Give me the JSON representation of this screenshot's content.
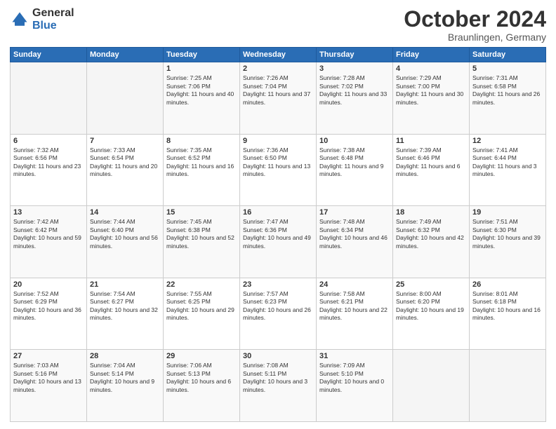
{
  "header": {
    "logo_general": "General",
    "logo_blue": "Blue",
    "month_title": "October 2024",
    "location": "Braunlingen, Germany"
  },
  "weekdays": [
    "Sunday",
    "Monday",
    "Tuesday",
    "Wednesday",
    "Thursday",
    "Friday",
    "Saturday"
  ],
  "weeks": [
    [
      {
        "day": "",
        "empty": true
      },
      {
        "day": "",
        "empty": true
      },
      {
        "day": "1",
        "sunrise": "Sunrise: 7:25 AM",
        "sunset": "Sunset: 7:06 PM",
        "daylight": "Daylight: 11 hours and 40 minutes."
      },
      {
        "day": "2",
        "sunrise": "Sunrise: 7:26 AM",
        "sunset": "Sunset: 7:04 PM",
        "daylight": "Daylight: 11 hours and 37 minutes."
      },
      {
        "day": "3",
        "sunrise": "Sunrise: 7:28 AM",
        "sunset": "Sunset: 7:02 PM",
        "daylight": "Daylight: 11 hours and 33 minutes."
      },
      {
        "day": "4",
        "sunrise": "Sunrise: 7:29 AM",
        "sunset": "Sunset: 7:00 PM",
        "daylight": "Daylight: 11 hours and 30 minutes."
      },
      {
        "day": "5",
        "sunrise": "Sunrise: 7:31 AM",
        "sunset": "Sunset: 6:58 PM",
        "daylight": "Daylight: 11 hours and 26 minutes."
      }
    ],
    [
      {
        "day": "6",
        "sunrise": "Sunrise: 7:32 AM",
        "sunset": "Sunset: 6:56 PM",
        "daylight": "Daylight: 11 hours and 23 minutes."
      },
      {
        "day": "7",
        "sunrise": "Sunrise: 7:33 AM",
        "sunset": "Sunset: 6:54 PM",
        "daylight": "Daylight: 11 hours and 20 minutes."
      },
      {
        "day": "8",
        "sunrise": "Sunrise: 7:35 AM",
        "sunset": "Sunset: 6:52 PM",
        "daylight": "Daylight: 11 hours and 16 minutes."
      },
      {
        "day": "9",
        "sunrise": "Sunrise: 7:36 AM",
        "sunset": "Sunset: 6:50 PM",
        "daylight": "Daylight: 11 hours and 13 minutes."
      },
      {
        "day": "10",
        "sunrise": "Sunrise: 7:38 AM",
        "sunset": "Sunset: 6:48 PM",
        "daylight": "Daylight: 11 hours and 9 minutes."
      },
      {
        "day": "11",
        "sunrise": "Sunrise: 7:39 AM",
        "sunset": "Sunset: 6:46 PM",
        "daylight": "Daylight: 11 hours and 6 minutes."
      },
      {
        "day": "12",
        "sunrise": "Sunrise: 7:41 AM",
        "sunset": "Sunset: 6:44 PM",
        "daylight": "Daylight: 11 hours and 3 minutes."
      }
    ],
    [
      {
        "day": "13",
        "sunrise": "Sunrise: 7:42 AM",
        "sunset": "Sunset: 6:42 PM",
        "daylight": "Daylight: 10 hours and 59 minutes."
      },
      {
        "day": "14",
        "sunrise": "Sunrise: 7:44 AM",
        "sunset": "Sunset: 6:40 PM",
        "daylight": "Daylight: 10 hours and 56 minutes."
      },
      {
        "day": "15",
        "sunrise": "Sunrise: 7:45 AM",
        "sunset": "Sunset: 6:38 PM",
        "daylight": "Daylight: 10 hours and 52 minutes."
      },
      {
        "day": "16",
        "sunrise": "Sunrise: 7:47 AM",
        "sunset": "Sunset: 6:36 PM",
        "daylight": "Daylight: 10 hours and 49 minutes."
      },
      {
        "day": "17",
        "sunrise": "Sunrise: 7:48 AM",
        "sunset": "Sunset: 6:34 PM",
        "daylight": "Daylight: 10 hours and 46 minutes."
      },
      {
        "day": "18",
        "sunrise": "Sunrise: 7:49 AM",
        "sunset": "Sunset: 6:32 PM",
        "daylight": "Daylight: 10 hours and 42 minutes."
      },
      {
        "day": "19",
        "sunrise": "Sunrise: 7:51 AM",
        "sunset": "Sunset: 6:30 PM",
        "daylight": "Daylight: 10 hours and 39 minutes."
      }
    ],
    [
      {
        "day": "20",
        "sunrise": "Sunrise: 7:52 AM",
        "sunset": "Sunset: 6:29 PM",
        "daylight": "Daylight: 10 hours and 36 minutes."
      },
      {
        "day": "21",
        "sunrise": "Sunrise: 7:54 AM",
        "sunset": "Sunset: 6:27 PM",
        "daylight": "Daylight: 10 hours and 32 minutes."
      },
      {
        "day": "22",
        "sunrise": "Sunrise: 7:55 AM",
        "sunset": "Sunset: 6:25 PM",
        "daylight": "Daylight: 10 hours and 29 minutes."
      },
      {
        "day": "23",
        "sunrise": "Sunrise: 7:57 AM",
        "sunset": "Sunset: 6:23 PM",
        "daylight": "Daylight: 10 hours and 26 minutes."
      },
      {
        "day": "24",
        "sunrise": "Sunrise: 7:58 AM",
        "sunset": "Sunset: 6:21 PM",
        "daylight": "Daylight: 10 hours and 22 minutes."
      },
      {
        "day": "25",
        "sunrise": "Sunrise: 8:00 AM",
        "sunset": "Sunset: 6:20 PM",
        "daylight": "Daylight: 10 hours and 19 minutes."
      },
      {
        "day": "26",
        "sunrise": "Sunrise: 8:01 AM",
        "sunset": "Sunset: 6:18 PM",
        "daylight": "Daylight: 10 hours and 16 minutes."
      }
    ],
    [
      {
        "day": "27",
        "sunrise": "Sunrise: 7:03 AM",
        "sunset": "Sunset: 5:16 PM",
        "daylight": "Daylight: 10 hours and 13 minutes."
      },
      {
        "day": "28",
        "sunrise": "Sunrise: 7:04 AM",
        "sunset": "Sunset: 5:14 PM",
        "daylight": "Daylight: 10 hours and 9 minutes."
      },
      {
        "day": "29",
        "sunrise": "Sunrise: 7:06 AM",
        "sunset": "Sunset: 5:13 PM",
        "daylight": "Daylight: 10 hours and 6 minutes."
      },
      {
        "day": "30",
        "sunrise": "Sunrise: 7:08 AM",
        "sunset": "Sunset: 5:11 PM",
        "daylight": "Daylight: 10 hours and 3 minutes."
      },
      {
        "day": "31",
        "sunrise": "Sunrise: 7:09 AM",
        "sunset": "Sunset: 5:10 PM",
        "daylight": "Daylight: 10 hours and 0 minutes."
      },
      {
        "day": "",
        "empty": true
      },
      {
        "day": "",
        "empty": true
      }
    ]
  ]
}
